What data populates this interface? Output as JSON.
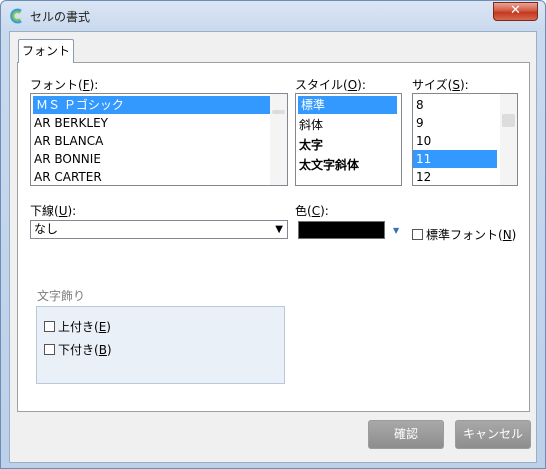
{
  "window": {
    "title": "セルの書式",
    "close_label": "✕"
  },
  "tabs": [
    {
      "label": "フォント",
      "active": true
    }
  ],
  "font": {
    "label": "フォント(",
    "hotkey": "F",
    "suffix": "):",
    "items": [
      "ＭＳ Ｐゴシック",
      "AR BERKLEY",
      "AR BLANCA",
      "AR BONNIE",
      "AR CARTER"
    ],
    "selected_index": 0
  },
  "style": {
    "label": "スタイル(",
    "hotkey": "O",
    "suffix": "):",
    "items": [
      "標準",
      "斜体",
      "太字",
      "太文字斜体"
    ],
    "selected_index": 0
  },
  "size": {
    "label": "サイズ(",
    "hotkey": "S",
    "suffix": "):",
    "items": [
      "8",
      "9",
      "10",
      "11",
      "12"
    ],
    "selected_index": 3
  },
  "underline": {
    "label": "下線(",
    "hotkey": "U",
    "suffix": "):",
    "value": "なし",
    "arrow": "▼"
  },
  "color": {
    "label": "色(",
    "hotkey": "C",
    "suffix": "):",
    "value_color": "#000000",
    "arrow": "▼"
  },
  "standard_font": {
    "label": "標準フォント(",
    "hotkey": "N",
    "suffix": ")",
    "checked": false
  },
  "effects": {
    "title": "文字飾り",
    "superscript": {
      "label": "上付き(",
      "hotkey": "E",
      "suffix": ")",
      "checked": false
    },
    "subscript": {
      "label": "下付き(",
      "hotkey": "B",
      "suffix": ")",
      "checked": false
    }
  },
  "buttons": {
    "ok": "確認",
    "cancel": "キャンセル"
  },
  "colors": {
    "selection": "#3399ff",
    "button_bg": "#9a9a9a",
    "close_red": "#c2391d"
  }
}
